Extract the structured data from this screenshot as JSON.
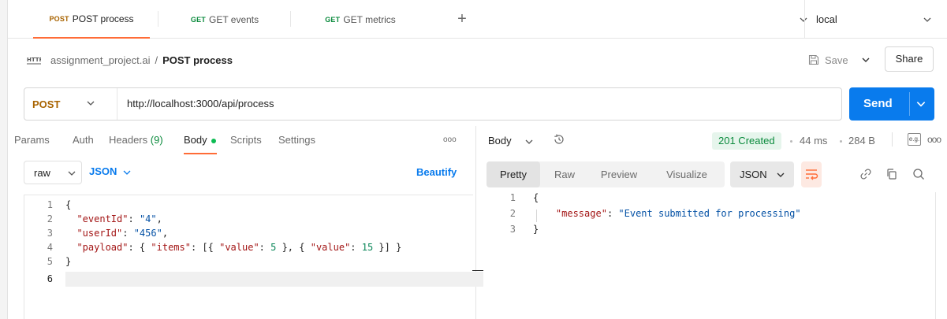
{
  "tabs": [
    {
      "method": "POST",
      "label": "POST process",
      "active": true,
      "method_color": "#a86300"
    },
    {
      "method": "GET",
      "label": "GET events",
      "active": false,
      "method_color": "#0a8a3c"
    },
    {
      "method": "GET",
      "label": "GET metrics",
      "active": false,
      "method_color": "#0a8a3c"
    }
  ],
  "new_tab_label": "+",
  "environment": {
    "selected": "local"
  },
  "breadcrumb": {
    "icon_text": "HTTP",
    "collection": "assignment_project.ai",
    "separator": "/",
    "request": "POST process"
  },
  "header_actions": {
    "save_label": "Save",
    "share_label": "Share"
  },
  "request": {
    "method": "POST",
    "url": "http://localhost:3000/api/process",
    "send_label": "Send",
    "subtabs": [
      {
        "label": "Params"
      },
      {
        "label": "Auth"
      },
      {
        "label": "Headers",
        "count": "(9)"
      },
      {
        "label": "Body"
      },
      {
        "label": "Scripts"
      },
      {
        "label": "Settings"
      }
    ],
    "more_label": "ooo",
    "body_mode": "raw",
    "body_type": "JSON",
    "beautify_label": "Beautify",
    "code_lines": [
      {
        "num": "1",
        "text": "{"
      },
      {
        "num": "2",
        "text": "  \"eventId\": \"4\","
      },
      {
        "num": "3",
        "text": "  \"userId\": \"456\","
      },
      {
        "num": "4",
        "text": "  \"payload\": { \"items\": [{ \"value\": 5 }, { \"value\": 15 }] }"
      },
      {
        "num": "5",
        "text": "}"
      },
      {
        "num": "6",
        "text": ""
      }
    ]
  },
  "response": {
    "body_label": "Body",
    "status": "201 Created",
    "time": "44 ms",
    "size": "284 B",
    "eg_label": "e.g.",
    "more_label": "ooo",
    "view_tabs": [
      {
        "label": "Pretty",
        "active": true
      },
      {
        "label": "Raw",
        "active": false
      },
      {
        "label": "Preview",
        "active": false
      },
      {
        "label": "Visualize",
        "active": false
      }
    ],
    "format": "JSON",
    "code_lines": [
      {
        "num": "1",
        "text": "{"
      },
      {
        "num": "2",
        "text": "    \"message\": \"Event submitted for processing\""
      },
      {
        "num": "3",
        "text": "}"
      }
    ]
  },
  "colors": {
    "accent": "#ff6c37",
    "send_blue": "#097bed",
    "post_method": "#a86300",
    "get_method": "#0a8a3c",
    "status_green": "#0a8a3c"
  }
}
